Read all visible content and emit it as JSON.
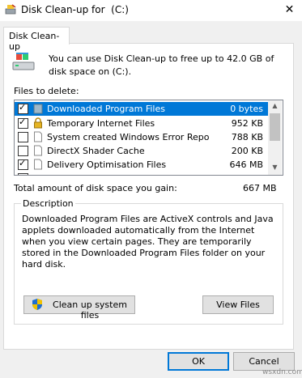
{
  "window": {
    "title": "Disk Clean-up for  (C:)",
    "close_glyph": "✕"
  },
  "tab": {
    "label": "Disk Clean-up"
  },
  "intro": {
    "text": "You can use Disk Clean-up to free up to 42.0 GB of disk space on  (C:)."
  },
  "files": {
    "label": "Files to delete:",
    "items": [
      {
        "name": "Downloaded Program Files",
        "size": "0 bytes",
        "checked": true,
        "selected": true,
        "icon": "folder-icon"
      },
      {
        "name": "Temporary Internet Files",
        "size": "952 KB",
        "checked": true,
        "selected": false,
        "icon": "lock-icon"
      },
      {
        "name": "System created Windows Error Reporti...",
        "size": "788 KB",
        "checked": false,
        "selected": false,
        "icon": "file-icon"
      },
      {
        "name": "DirectX Shader Cache",
        "size": "200 KB",
        "checked": false,
        "selected": false,
        "icon": "file-icon"
      },
      {
        "name": "Delivery Optimisation Files",
        "size": "646 MB",
        "checked": true,
        "selected": false,
        "icon": "file-icon"
      }
    ]
  },
  "total": {
    "label": "Total amount of disk space you gain:",
    "value": "667 MB"
  },
  "description": {
    "title": "Description",
    "text": "Downloaded Program Files are ActiveX controls and Java applets downloaded automatically from the Internet when you view certain pages. They are temporarily stored in the Downloaded Program Files folder on your hard disk."
  },
  "buttons": {
    "cleanup_system": "Clean up system files",
    "view_files": "View Files",
    "ok": "OK",
    "cancel": "Cancel"
  },
  "watermark": "wsxdn.com",
  "colors": {
    "selection": "#0078d7",
    "dialog_bg": "#f0f0f0"
  }
}
